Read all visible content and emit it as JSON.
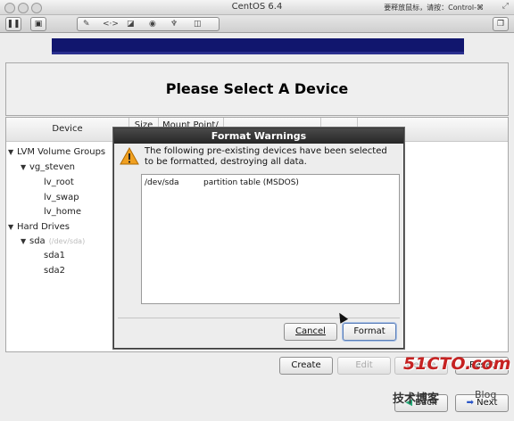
{
  "window": {
    "title": "CentOS 6.4",
    "hint": "要释放鼠标，请按：Control-⌘"
  },
  "toolbar": {
    "pause_icon": "pause-icon",
    "snapshot_icon": "disk-icon",
    "settings_icon": "wrench-icon",
    "network_icon": "arrows-icon",
    "restore_icon": "window-icon"
  },
  "page": {
    "title": "Please Select A Device"
  },
  "table": {
    "headers": {
      "device": "Device",
      "size": "Size",
      "mount": "Mount Point/"
    },
    "rows": [
      {
        "label": "LVM Volume Groups",
        "level": 0,
        "expander": "▼"
      },
      {
        "label": "vg_steven",
        "level": 1,
        "expander": "▼"
      },
      {
        "label": "lv_root",
        "level": 2,
        "expander": ""
      },
      {
        "label": "lv_swap",
        "level": 2,
        "expander": ""
      },
      {
        "label": "lv_home",
        "level": 2,
        "expander": ""
      },
      {
        "label": "Hard Drives",
        "level": 0,
        "expander": "▼"
      },
      {
        "label": "sda",
        "level": 1,
        "expander": "▼",
        "path": "(/dev/sda)"
      },
      {
        "label": "sda1",
        "level": 2,
        "expander": ""
      },
      {
        "label": "sda2",
        "level": 2,
        "expander": ""
      }
    ]
  },
  "buttons": {
    "create": "Create",
    "edit": "Edit",
    "delete": "Delete",
    "reset": "Reset",
    "back": "Back",
    "next": "Next"
  },
  "dialog": {
    "title": "Format Warnings",
    "message": "The following pre-existing devices have been selected to be formatted, destroying all data.",
    "devices": [
      {
        "device": "/dev/sda",
        "description": "partition table (MSDOS)"
      }
    ],
    "cancel": "Cancel",
    "format": "Format"
  },
  "watermark": {
    "site": "51CTO.com",
    "sub": "技术博客",
    "blog": "Blog"
  }
}
